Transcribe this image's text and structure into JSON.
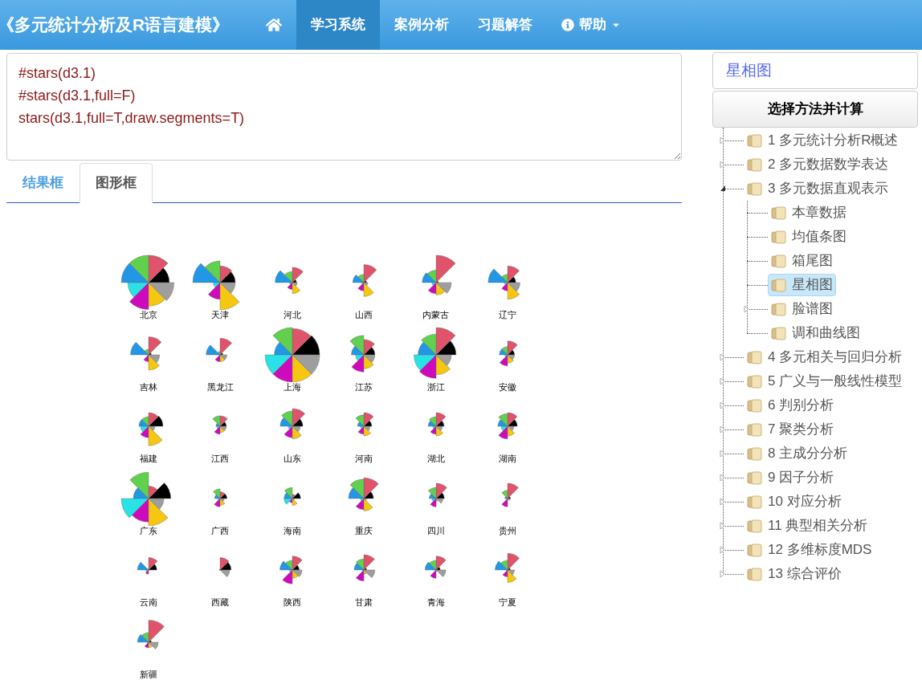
{
  "navbar": {
    "brand": "《多元统计分析及R语言建模》",
    "items": [
      {
        "kind": "home",
        "selected": false
      },
      {
        "kind": "link",
        "label": "学习系统",
        "selected": true
      },
      {
        "kind": "link",
        "label": "案例分析",
        "selected": false
      },
      {
        "kind": "link",
        "label": "习题解答",
        "selected": false
      },
      {
        "kind": "dropdown",
        "label": "帮助",
        "selected": false
      }
    ]
  },
  "editor": {
    "lines": [
      "#stars(d3.1)",
      "#stars(d3.1,full=F)",
      "stars(d3.1,full=T,draw.segments=T)"
    ]
  },
  "tabs": [
    {
      "label": "结果框",
      "selected": false
    },
    {
      "label": "图形框",
      "selected": true
    }
  ],
  "star_plot": {
    "labels": [
      "北京",
      "天津",
      "河北",
      "山西",
      "内蒙古",
      "辽宁",
      "吉林",
      "黑龙江",
      "上海",
      "江苏",
      "浙江",
      "安徽",
      "福建",
      "江西",
      "山东",
      "河南",
      "湖北",
      "湖南",
      "广东",
      "广西",
      "海南",
      "重庆",
      "四川",
      "贵州",
      "云南",
      "西藏",
      "陕西",
      "甘肃",
      "青海",
      "宁夏",
      "新疆"
    ]
  },
  "sidebar": {
    "current": "星相图",
    "button": "选择方法并计算",
    "tree": [
      {
        "label": "1 多元统计分析R概述",
        "kind": "branch",
        "expanded": false,
        "selected": false
      },
      {
        "label": "2 多元数据数学表达",
        "kind": "branch",
        "expanded": false,
        "selected": false
      },
      {
        "label": "3 多元数据直观表示",
        "kind": "branch",
        "expanded": true,
        "selected": false,
        "children": [
          {
            "label": "本章数据",
            "kind": "leaf",
            "selected": false
          },
          {
            "label": "均值条图",
            "kind": "leaf",
            "selected": false
          },
          {
            "label": "箱尾图",
            "kind": "leaf",
            "selected": false
          },
          {
            "label": "星相图",
            "kind": "leaf",
            "selected": true
          },
          {
            "label": "脸谱图",
            "kind": "branch",
            "expanded": false,
            "selected": false
          },
          {
            "label": "调和曲线图",
            "kind": "leaf",
            "selected": false
          }
        ]
      },
      {
        "label": "4 多元相关与回归分析",
        "kind": "branch",
        "expanded": false,
        "selected": false
      },
      {
        "label": "5 广义与一般线性模型",
        "kind": "branch",
        "expanded": false,
        "selected": false
      },
      {
        "label": "6 判别分析",
        "kind": "branch",
        "expanded": false,
        "selected": false
      },
      {
        "label": "7 聚类分析",
        "kind": "branch",
        "expanded": false,
        "selected": false
      },
      {
        "label": "8 主成分分析",
        "kind": "branch",
        "expanded": false,
        "selected": false
      },
      {
        "label": "9 因子分析",
        "kind": "branch",
        "expanded": false,
        "selected": false
      },
      {
        "label": "10 对应分析",
        "kind": "branch",
        "expanded": false,
        "selected": false
      },
      {
        "label": "11 典型相关分析",
        "kind": "branch",
        "expanded": false,
        "selected": false
      },
      {
        "label": "12 多维标度MDS",
        "kind": "branch",
        "expanded": false,
        "selected": false
      },
      {
        "label": "13 综合评价",
        "kind": "branch",
        "expanded": false,
        "selected": false
      }
    ]
  }
}
